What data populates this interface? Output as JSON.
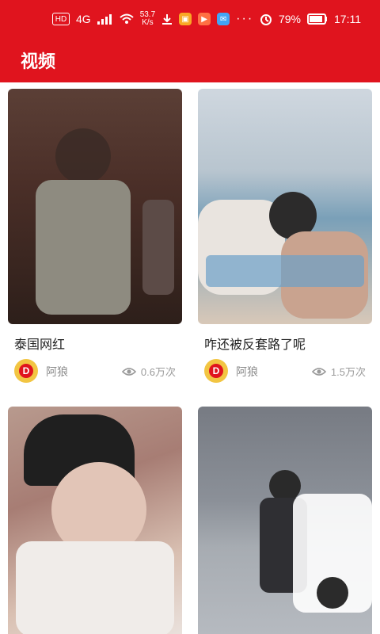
{
  "status_bar": {
    "hd": "HD",
    "network": "4G",
    "speed_value": "53.7",
    "speed_unit": "K/s",
    "battery_percent": "79%",
    "time": "17:11"
  },
  "header": {
    "title": "视频"
  },
  "cards": [
    {
      "caption": "泰国网红",
      "author": "阿狼",
      "views": "0.6万次"
    },
    {
      "caption": "咋还被反套路了呢",
      "author": "阿狼",
      "views": "1.5万次"
    },
    {
      "caption": "",
      "author": "",
      "views": ""
    },
    {
      "caption": "",
      "author": "",
      "views": ""
    }
  ],
  "colors": {
    "brand": "#e0141e",
    "text_primary": "#222222",
    "text_secondary": "#8a8a8a"
  },
  "icons": {
    "alarm": "alarm-icon",
    "battery": "battery-icon",
    "signal": "signal-icon",
    "wifi": "wifi-icon",
    "download": "download-icon",
    "eye": "eye-icon"
  }
}
